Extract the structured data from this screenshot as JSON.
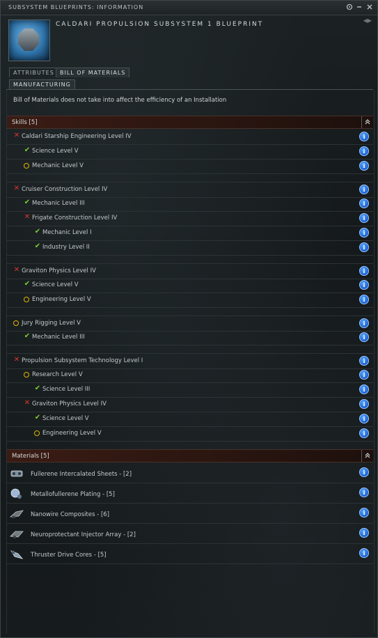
{
  "window": {
    "title": "SUBSYSTEM BLUEPRINTS: INFORMATION",
    "blueprint_name": "CALDARI PROPULSION SUBSYSTEM 1 BLUEPRINT"
  },
  "tabs": {
    "attributes": "ATTRIBUTES",
    "bill_of_materials": "BILL OF MATERIALS",
    "manufacturing": "MANUFACTURING"
  },
  "notice": "Bill of Materials does not take into affect the efficiency of an Installation",
  "skills_header": "Skills [5]",
  "materials_header": "Materials [5]",
  "skills": [
    {
      "label": "Caldari Starship Engineering Level IV",
      "status": "x"
    },
    {
      "label": "Science Level V",
      "status": "ok"
    },
    {
      "label": "Mechanic Level V",
      "status": "o"
    },
    {
      "label": "Cruiser Construction Level IV",
      "status": "x"
    },
    {
      "label": "Mechanic Level III",
      "status": "ok"
    },
    {
      "label": "Frigate Construction Level IV",
      "status": "x"
    },
    {
      "label": "Mechanic Level I",
      "status": "ok"
    },
    {
      "label": "Industry Level II",
      "status": "ok"
    },
    {
      "label": "Graviton Physics Level IV",
      "status": "x"
    },
    {
      "label": "Science Level V",
      "status": "ok"
    },
    {
      "label": "Engineering Level V",
      "status": "o"
    },
    {
      "label": "Jury Rigging Level V",
      "status": "o"
    },
    {
      "label": "Mechanic Level III",
      "status": "ok"
    },
    {
      "label": "Propulsion Subsystem Technology Level I",
      "status": "x"
    },
    {
      "label": "Research Level V",
      "status": "o"
    },
    {
      "label": "Science Level III",
      "status": "ok"
    },
    {
      "label": "Graviton Physics Level IV",
      "status": "x"
    },
    {
      "label": "Science Level V",
      "status": "ok"
    },
    {
      "label": "Engineering Level V",
      "status": "o"
    }
  ],
  "materials": [
    {
      "label": "Fullerene Intercalated Sheets - [2]"
    },
    {
      "label": "Metallofullerene Plating - [5]"
    },
    {
      "label": "Nanowire Composites - [6]"
    },
    {
      "label": "Neuroprotectant Injector Array - [2]"
    },
    {
      "label": "Thruster Drive Cores - [5]"
    }
  ],
  "icons": {
    "fail": "x-icon",
    "ok": "check-icon",
    "pending": "circle-icon",
    "info": "info-icon"
  },
  "colors": {
    "fail": "#e0352b",
    "ok": "#7ccf2f",
    "pending": "#e2b400",
    "info": "#1a5fd0"
  }
}
